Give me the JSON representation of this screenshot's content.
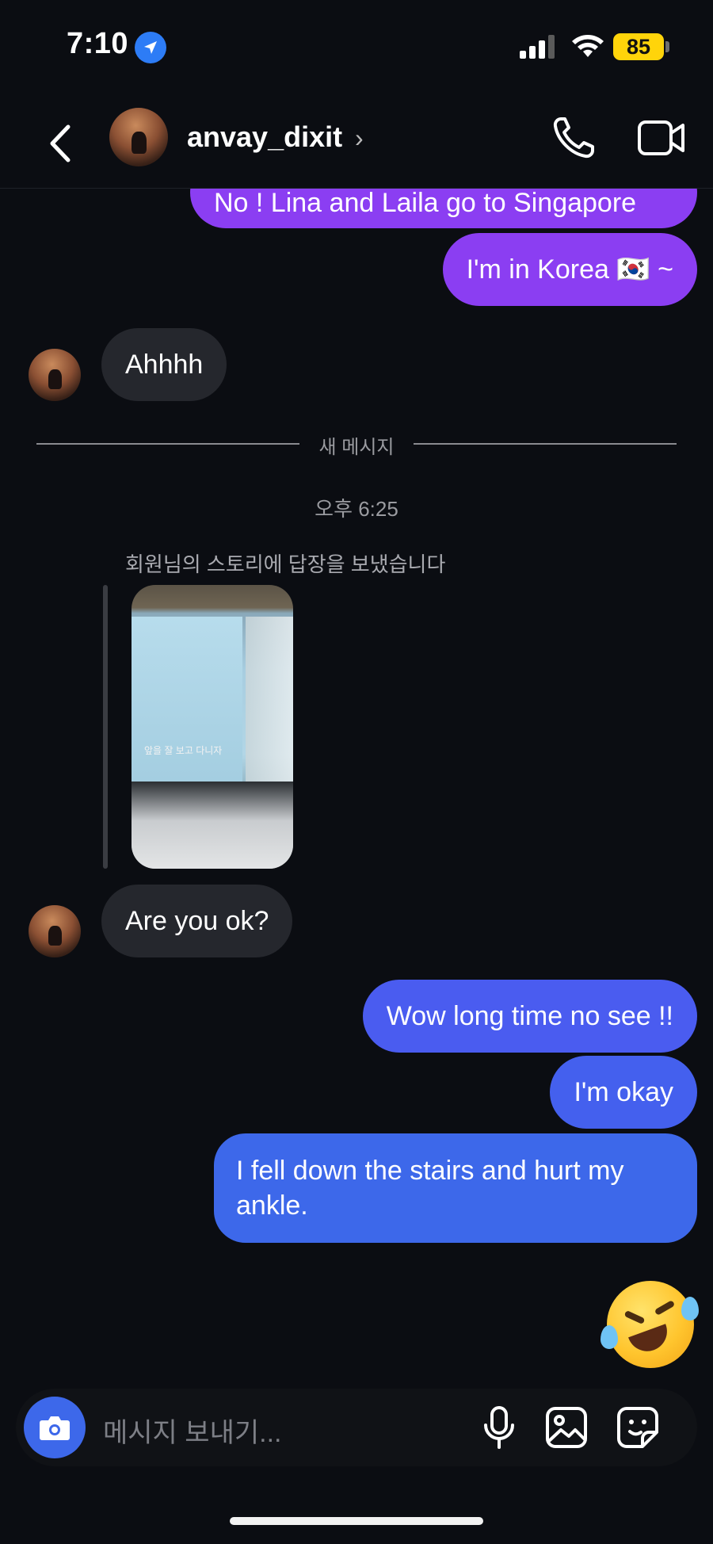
{
  "status_bar": {
    "time": "7:10",
    "battery": "85"
  },
  "header": {
    "username": "anvay_dixit",
    "chevron": "›"
  },
  "messages": {
    "out_1": "No ! Lina and Laila go to Singapore",
    "out_2": "I'm in Korea 🇰🇷 ~",
    "in_1": "Ahhhh",
    "divider": "새 메시지",
    "timestamp": "오후 6:25",
    "story_caption": "회원님의 스토리에 답장을 보냈습니다",
    "story_overlay": "앞을 잘 보고 다니자",
    "in_2": "Are you ok?",
    "out_3": "Wow long time no see !!",
    "out_4": "I'm okay",
    "out_5": "I fell down the stairs and hurt my ankle.",
    "reaction_emoji_name": "rolling-on-the-floor-laughing"
  },
  "composer": {
    "placeholder": "메시지 보내기..."
  },
  "colors": {
    "background": "#0b0d12",
    "bubble_purple": "#8b3ef2",
    "bubble_blue": "#4a5cf0",
    "bubble_incoming": "#25272d",
    "camera_button": "#3d68ea",
    "battery": "#ffd40a"
  }
}
